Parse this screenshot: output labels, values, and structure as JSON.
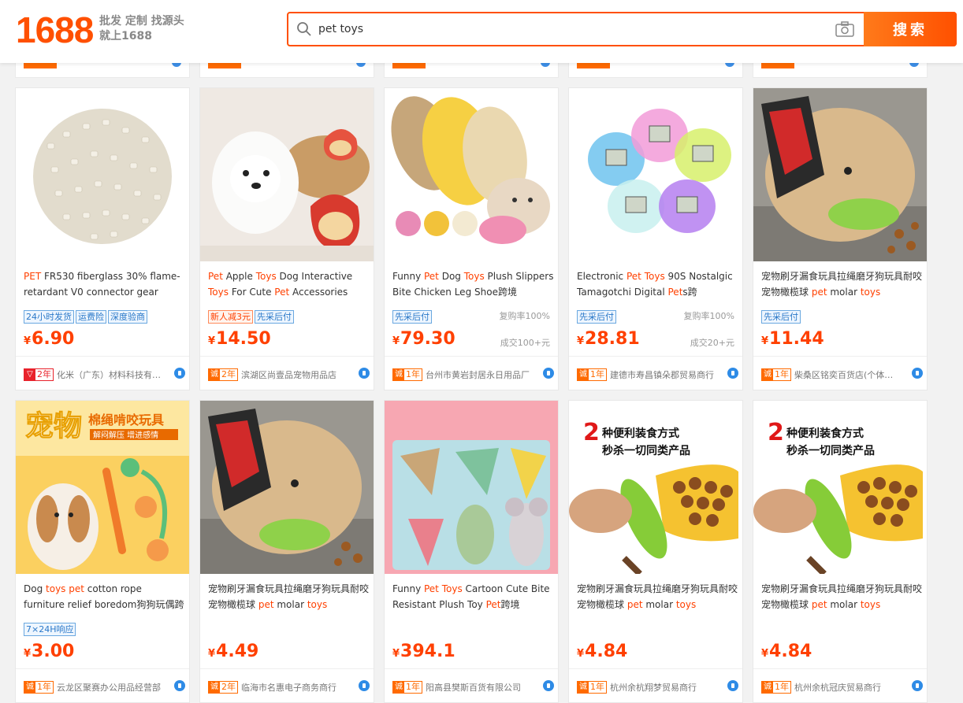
{
  "header": {
    "logo": "1688",
    "tagline_line1": "批发 定制 找源头",
    "tagline_line2": "就上1688",
    "search_value": "pet toys",
    "search_button": "搜索"
  },
  "products": [
    {
      "title_parts": [
        {
          "t": "PET",
          "h": true
        },
        {
          "t": " FR530 fiberglass 30% flame-retardant V0 connector gear",
          "h": false
        }
      ],
      "tags": [
        {
          "t": "24小时发货",
          "red": false
        },
        {
          "t": "运费险",
          "red": false
        },
        {
          "t": "深度验商",
          "red": false
        }
      ],
      "repeat_rate": "",
      "price": "6.90",
      "currency": "¥",
      "sold": "",
      "badge_years": "2年",
      "badge_type": "red",
      "shop": "化米（广东）材料科技有限公司",
      "image_desc": "pellets"
    },
    {
      "title_parts": [
        {
          "t": "Pet",
          "h": true
        },
        {
          "t": " Apple ",
          "h": false
        },
        {
          "t": "Toys",
          "h": true
        },
        {
          "t": " Dog Interactive ",
          "h": false
        },
        {
          "t": "Toys",
          "h": true
        },
        {
          "t": " For Cute ",
          "h": false
        },
        {
          "t": "Pet",
          "h": true
        },
        {
          "t": " Accessories",
          "h": false
        }
      ],
      "tags": [
        {
          "t": "新人减3元",
          "red": true
        },
        {
          "t": "先采后付",
          "red": false
        }
      ],
      "repeat_rate": "",
      "price": "14.50",
      "currency": "¥",
      "sold": "",
      "badge_years": "2年",
      "badge_type": "orange",
      "shop": "滨湖区尚壹品宠物用品店",
      "image_desc": "dog-apple"
    },
    {
      "title_parts": [
        {
          "t": "Funny ",
          "h": false
        },
        {
          "t": "Pet",
          "h": true
        },
        {
          "t": " Dog ",
          "h": false
        },
        {
          "t": "Toys",
          "h": true
        },
        {
          "t": " Plush Slippers Bite Chicken Leg Shoe跨境",
          "h": false
        }
      ],
      "tags": [
        {
          "t": "先采后付",
          "red": false
        }
      ],
      "repeat_rate": "复购率100%",
      "price": "79.30",
      "currency": "¥",
      "sold": "成交100+元",
      "badge_years": "1年",
      "badge_type": "orange",
      "shop": "台州市黄岩封居永日用品厂",
      "image_desc": "slippers"
    },
    {
      "title_parts": [
        {
          "t": "Electronic ",
          "h": false
        },
        {
          "t": "Pet",
          "h": true
        },
        {
          "t": " ",
          "h": false
        },
        {
          "t": "Toys",
          "h": true
        },
        {
          "t": " 90S Nostalgic Tamagotchi Digital ",
          "h": false
        },
        {
          "t": "Pet",
          "h": true
        },
        {
          "t": "s跨",
          "h": false
        }
      ],
      "tags": [
        {
          "t": "先采后付",
          "red": false
        }
      ],
      "repeat_rate": "复购率100%",
      "price": "28.81",
      "currency": "¥",
      "sold": "成交20+元",
      "badge_years": "1年",
      "badge_type": "orange",
      "shop": "建德市寿昌镇朵郡贸易商行",
      "image_desc": "tamagotchi"
    },
    {
      "title_parts": [
        {
          "t": "宠物刷牙漏食玩具拉绳磨牙狗玩具耐咬宠物橄榄球 ",
          "h": false
        },
        {
          "t": "pet",
          "h": true
        },
        {
          "t": " molar ",
          "h": false
        },
        {
          "t": "toys",
          "h": true
        }
      ],
      "tags": [
        {
          "t": "先采后付",
          "red": false
        }
      ],
      "repeat_rate": "",
      "price": "11.44",
      "currency": "¥",
      "sold": "",
      "badge_years": "1年",
      "badge_type": "orange",
      "shop": "柴桑区铭奕百货店(个体工商户)",
      "image_desc": "bulldog"
    },
    {
      "title_parts": [
        {
          "t": "Dog ",
          "h": false
        },
        {
          "t": "toys pet",
          "h": true
        },
        {
          "t": " cotton rope furniture relief boredom狗狗玩偶跨",
          "h": false
        }
      ],
      "tags": [
        {
          "t": "7×24H响应",
          "red": false
        }
      ],
      "repeat_rate": "",
      "price": "3.00",
      "currency": "¥",
      "sold": "",
      "badge_years": "1年",
      "badge_type": "orange",
      "shop": "云龙区聚赛办公用品经营部",
      "image_desc": "rope"
    },
    {
      "title_parts": [
        {
          "t": "宠物刷牙漏食玩具拉绳磨牙狗玩具耐咬宠物橄榄球 ",
          "h": false
        },
        {
          "t": "pet",
          "h": true
        },
        {
          "t": " molar ",
          "h": false
        },
        {
          "t": "toys",
          "h": true
        }
      ],
      "tags": [],
      "repeat_rate": "",
      "price": "4.49",
      "currency": "¥",
      "sold": "",
      "badge_years": "2年",
      "badge_type": "orange",
      "shop": "临海市名惠电子商务商行",
      "image_desc": "bulldog"
    },
    {
      "title_parts": [
        {
          "t": "Funny ",
          "h": false
        },
        {
          "t": "Pet",
          "h": true
        },
        {
          "t": " ",
          "h": false
        },
        {
          "t": "Toys",
          "h": true
        },
        {
          "t": " Cartoon Cute Bite Resistant Plush Toy ",
          "h": false
        },
        {
          "t": "Pet",
          "h": true
        },
        {
          "t": "跨境",
          "h": false
        }
      ],
      "tags": [],
      "repeat_rate": "",
      "price": "394.1",
      "currency": "¥",
      "sold": "",
      "badge_years": "1年",
      "badge_type": "orange",
      "shop": "阳高县樊斯百货有限公司",
      "image_desc": "plush"
    },
    {
      "title_parts": [
        {
          "t": "宠物刷牙漏食玩具拉绳磨牙狗玩具耐咬宠物橄榄球 ",
          "h": false
        },
        {
          "t": "pet",
          "h": true
        },
        {
          "t": " molar ",
          "h": false
        },
        {
          "t": "toys",
          "h": true
        }
      ],
      "tags": [],
      "repeat_rate": "",
      "price": "4.84",
      "currency": "¥",
      "sold": "",
      "badge_years": "1年",
      "badge_type": "orange",
      "shop": "杭州余杭翔梦贸易商行",
      "image_desc": "feeder",
      "image_caption1": "种便利装食方式",
      "image_caption2": "秒杀一切同类产品"
    },
    {
      "title_parts": [
        {
          "t": "宠物刷牙漏食玩具拉绳磨牙狗玩具耐咬宠物橄榄球 ",
          "h": false
        },
        {
          "t": "pet",
          "h": true
        },
        {
          "t": " molar ",
          "h": false
        },
        {
          "t": "toys",
          "h": true
        }
      ],
      "tags": [],
      "repeat_rate": "",
      "price": "4.84",
      "currency": "¥",
      "sold": "",
      "badge_years": "1年",
      "badge_type": "orange",
      "shop": "杭州余杭冠庆贸易商行",
      "image_desc": "feeder",
      "image_caption1": "种便利装食方式",
      "image_caption2": "秒杀一切同类产品"
    }
  ],
  "rope_banner": {
    "big": "宠物",
    "small": "棉绳啃咬玩具",
    "sub": "解闷解压 增进感情"
  }
}
